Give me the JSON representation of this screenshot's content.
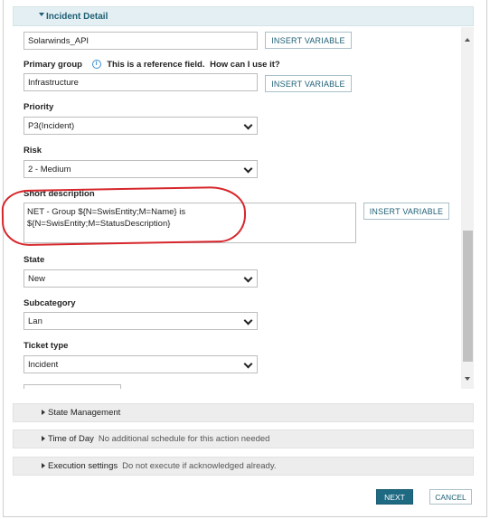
{
  "section": {
    "title": "Incident Detail"
  },
  "insert_variable_label": "INSERT VARIABLE",
  "fields": {
    "top_value": "Solarwinds_API",
    "primary_group": {
      "label": "Primary group",
      "ref_text": "This is a reference field.",
      "ref_link": "How can I use it?",
      "value": "Infrastructure"
    },
    "priority": {
      "label": "Priority",
      "value": "P3(Incident)"
    },
    "risk": {
      "label": "Risk",
      "value": "2 - Medium"
    },
    "short_description": {
      "label": "Short description",
      "line1": "NET - Group ${N=SwisEntity;M=Name} is",
      "line2": "${N=SwisEntity;M=StatusDescription}"
    },
    "state": {
      "label": "State",
      "value": "New"
    },
    "subcategory": {
      "label": "Subcategory",
      "value": "Lan"
    },
    "ticket_type": {
      "label": "Ticket type",
      "value": "Incident"
    }
  },
  "collapsed_sections": [
    {
      "title": "State Management",
      "detail": ""
    },
    {
      "title": "Time of Day",
      "detail": "No additional schedule for this action needed"
    },
    {
      "title": "Execution settings",
      "detail": "Do not execute if acknowledged already."
    }
  ],
  "buttons": {
    "next": "NEXT",
    "cancel": "CANCEL"
  },
  "colors": {
    "accent": "#1d5f74",
    "header_bg": "#e4eff3",
    "annotation": "#d6262b"
  }
}
